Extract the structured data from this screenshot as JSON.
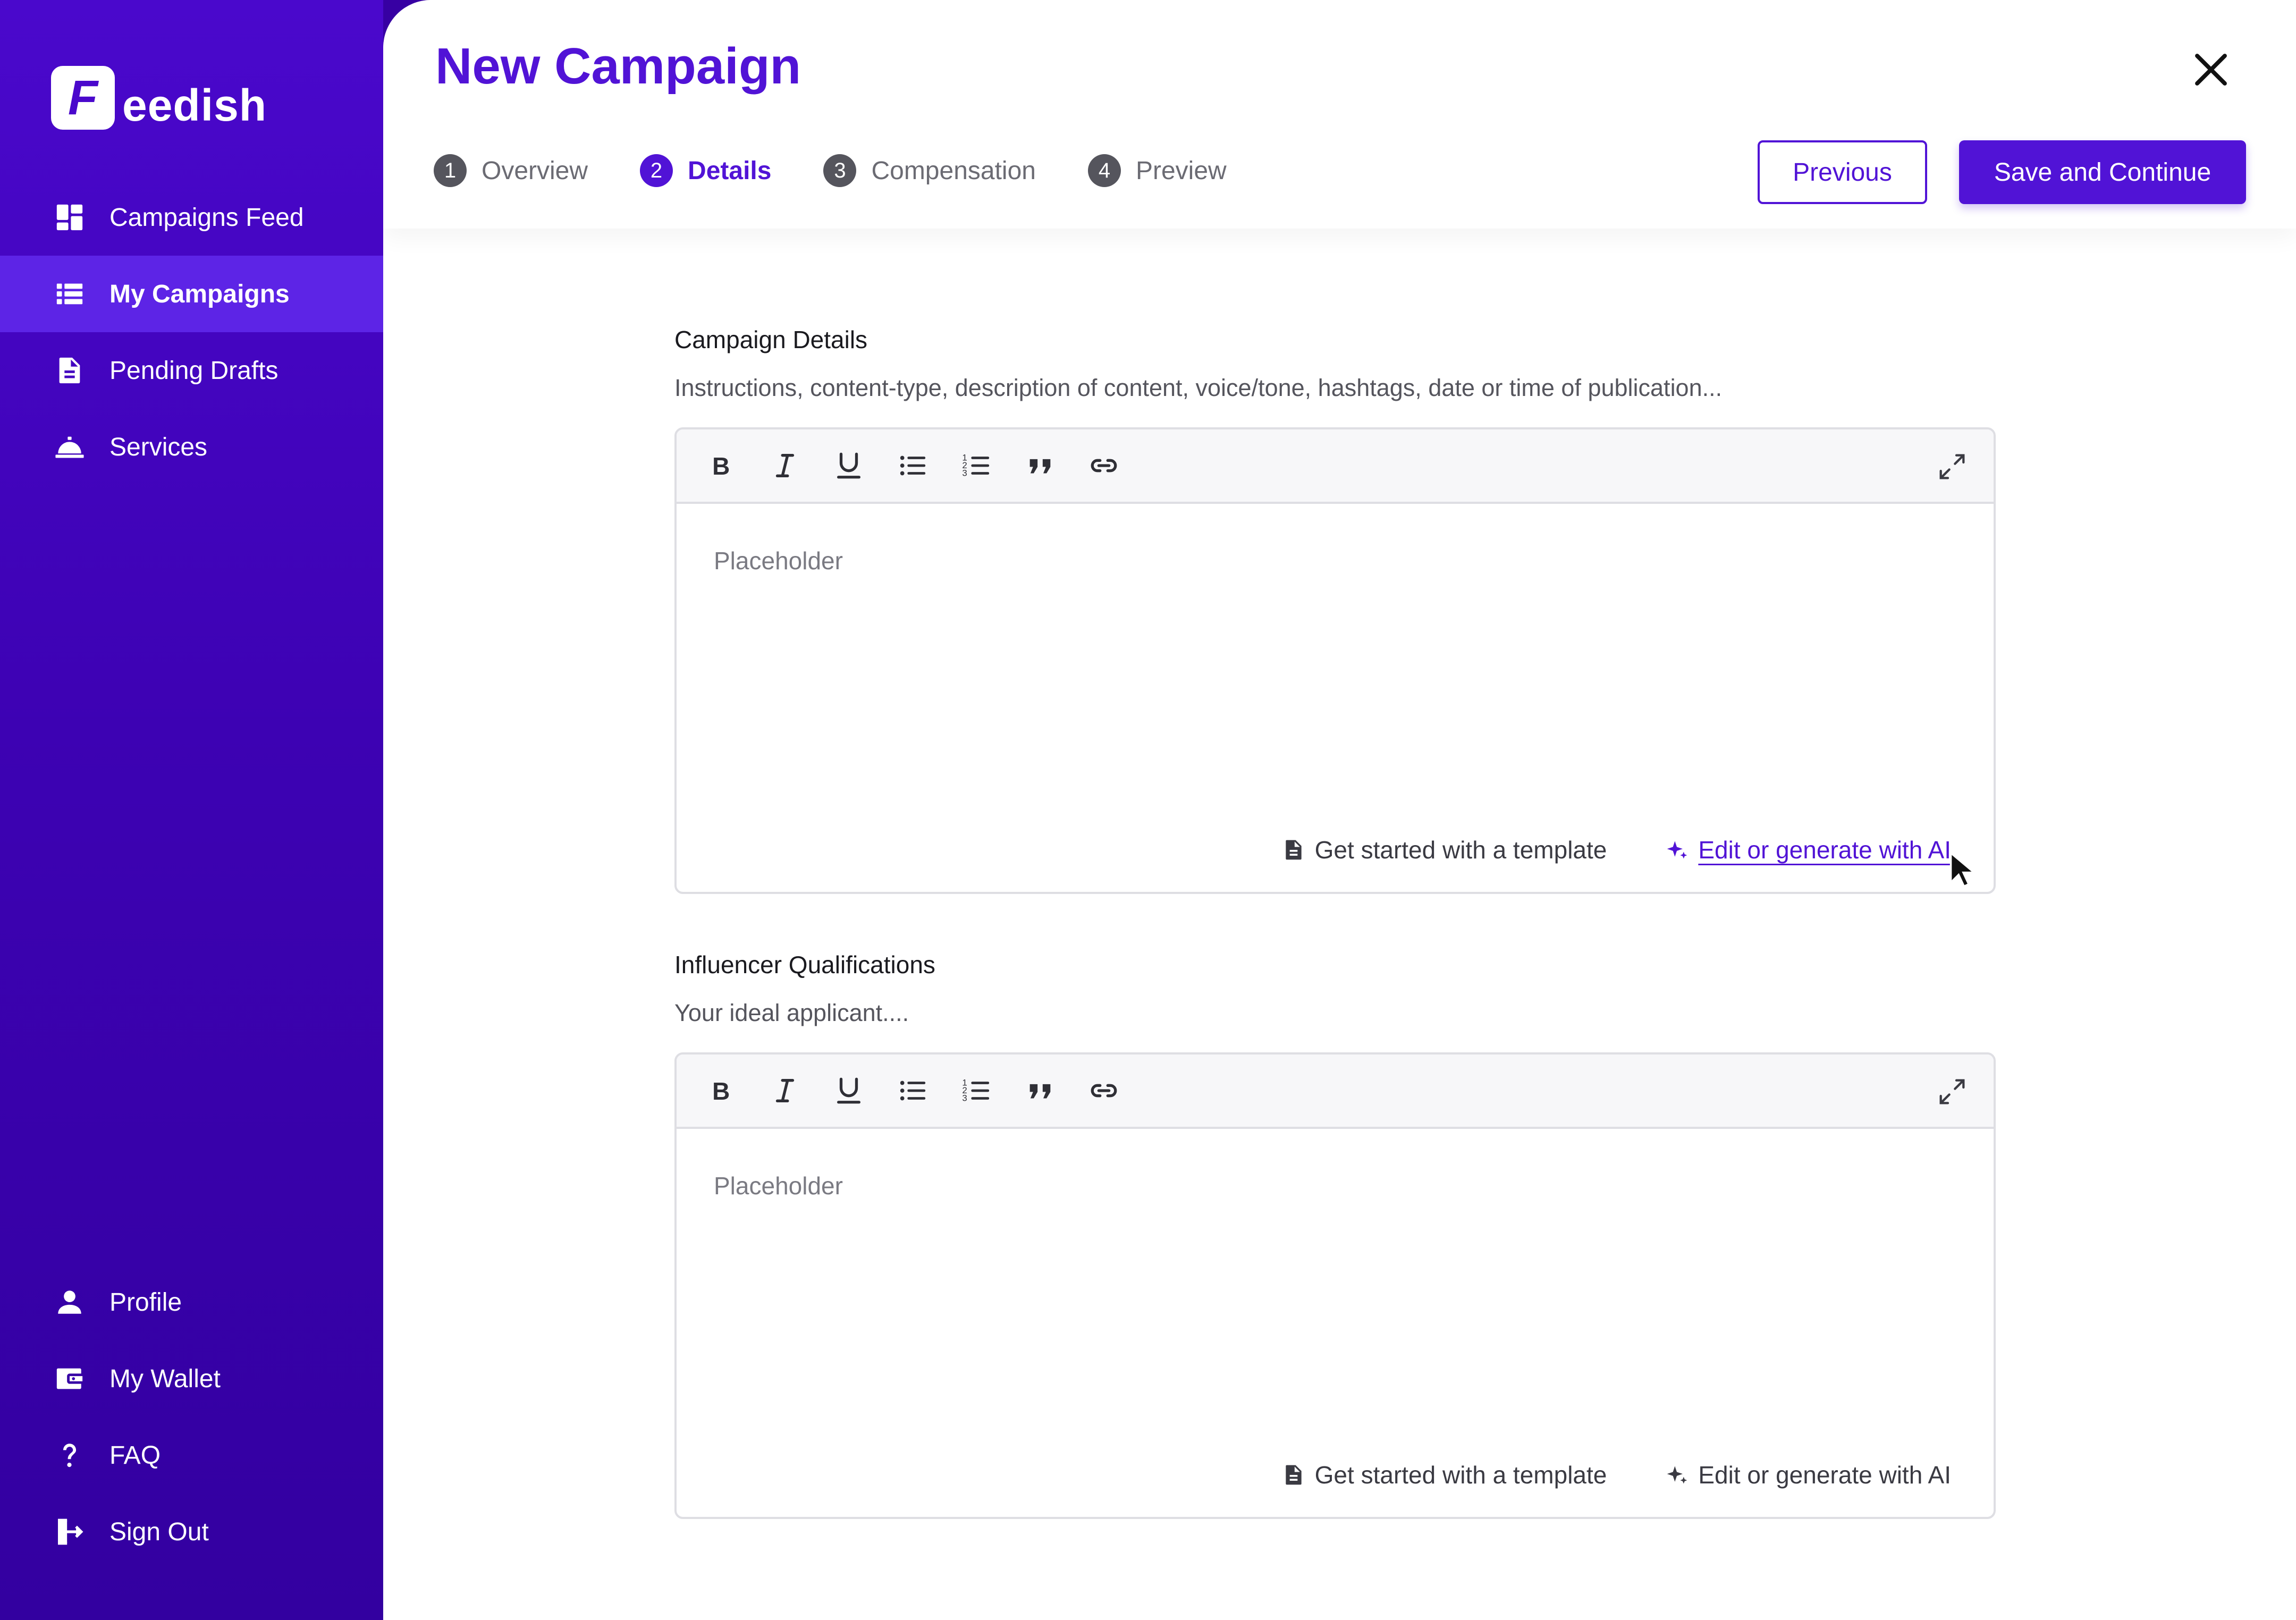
{
  "brand": {
    "logo_letter": "F",
    "name": "eedish"
  },
  "sidebar": {
    "top_items": [
      {
        "label": "Campaigns Feed",
        "icon": "dashboard-icon"
      },
      {
        "label": "My Campaigns",
        "icon": "list-icon",
        "active": true
      },
      {
        "label": "Pending Drafts",
        "icon": "document-icon"
      },
      {
        "label": "Services",
        "icon": "service-bell-icon"
      }
    ],
    "bottom_items": [
      {
        "label": "Profile",
        "icon": "person-icon"
      },
      {
        "label": "My Wallet",
        "icon": "wallet-icon"
      },
      {
        "label": "FAQ",
        "icon": "question-icon"
      },
      {
        "label": "Sign Out",
        "icon": "sign-out-icon"
      }
    ]
  },
  "header": {
    "title": "New Campaign",
    "steps": [
      {
        "num": "1",
        "label": "Overview"
      },
      {
        "num": "2",
        "label": "Details",
        "active": true
      },
      {
        "num": "3",
        "label": "Compensation"
      },
      {
        "num": "4",
        "label": "Preview"
      }
    ],
    "previous_label": "Previous",
    "save_label": "Save and Continue"
  },
  "sections": [
    {
      "title": "Campaign Details",
      "subtitle": "Instructions, content-type, description of content, voice/tone, hashtags, date or time of publication...",
      "placeholder": "Placeholder",
      "template_label": "Get started with a template",
      "ai_label": "Edit or generate with AI"
    },
    {
      "title": "Influencer Qualifications",
      "subtitle": "Your ideal applicant....",
      "placeholder": "Placeholder",
      "template_label": "Get started with a template",
      "ai_label": "Edit or generate with AI"
    }
  ],
  "colors": {
    "brand": "#5113d6",
    "sidebar": "#3d02b3",
    "active_item": "#5d24e6"
  }
}
